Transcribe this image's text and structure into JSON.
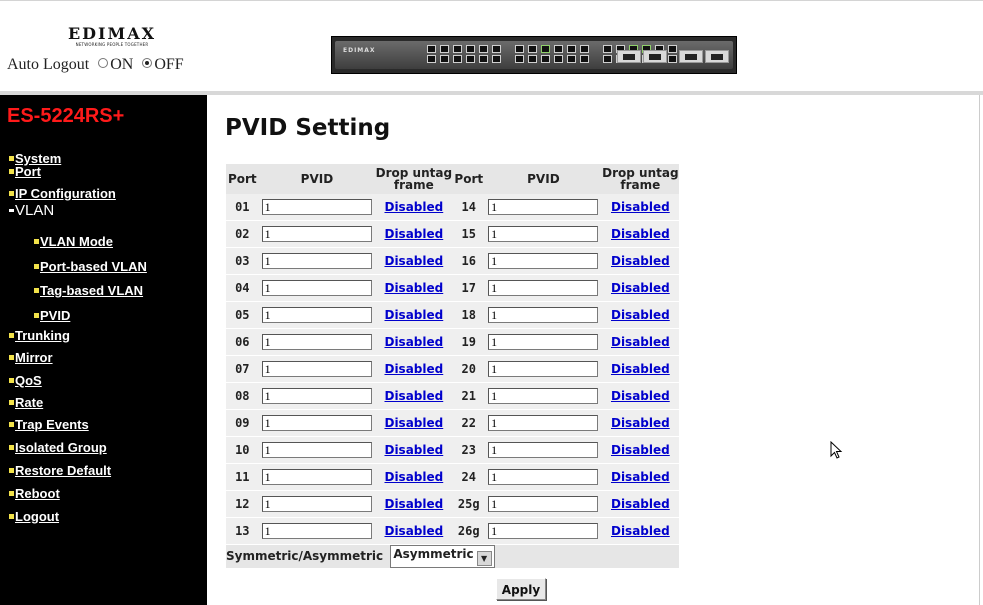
{
  "header": {
    "brand": "EDIMAX",
    "slogan": "NETWORKING PEOPLE TOGETHER",
    "auto_logout_label": "Auto Logout",
    "on_label": "ON",
    "off_label": "OFF",
    "auto_logout_selected": "OFF",
    "device_brand": "EDIMAX"
  },
  "sidebar": {
    "model": "ES-5224RS+",
    "items": [
      {
        "label": "System"
      },
      {
        "label": "Port"
      },
      {
        "label": "IP Configuration"
      },
      {
        "label": "VLAN"
      },
      {
        "label": "VLAN Mode"
      },
      {
        "label": "Port-based VLAN"
      },
      {
        "label": "Tag-based VLAN"
      },
      {
        "label": "PVID"
      },
      {
        "label": "Trunking"
      },
      {
        "label": "Mirror"
      },
      {
        "label": "QoS"
      },
      {
        "label": "Rate"
      },
      {
        "label": "Trap Events"
      },
      {
        "label": "Isolated Group"
      },
      {
        "label": "Restore Default"
      },
      {
        "label": "Reboot"
      },
      {
        "label": "Logout"
      }
    ]
  },
  "main": {
    "title": "PVID Setting",
    "headers": {
      "port": "Port",
      "pvid": "PVID",
      "drop_line1": "Drop untag",
      "drop_line2": "frame"
    },
    "rows": [
      {
        "l_port": "01",
        "l_pvid": "1",
        "l_drop": "Disabled",
        "r_port": "14",
        "r_pvid": "1",
        "r_drop": "Disabled"
      },
      {
        "l_port": "02",
        "l_pvid": "1",
        "l_drop": "Disabled",
        "r_port": "15",
        "r_pvid": "1",
        "r_drop": "Disabled"
      },
      {
        "l_port": "03",
        "l_pvid": "1",
        "l_drop": "Disabled",
        "r_port": "16",
        "r_pvid": "1",
        "r_drop": "Disabled"
      },
      {
        "l_port": "04",
        "l_pvid": "1",
        "l_drop": "Disabled",
        "r_port": "17",
        "r_pvid": "1",
        "r_drop": "Disabled"
      },
      {
        "l_port": "05",
        "l_pvid": "1",
        "l_drop": "Disabled",
        "r_port": "18",
        "r_pvid": "1",
        "r_drop": "Disabled"
      },
      {
        "l_port": "06",
        "l_pvid": "1",
        "l_drop": "Disabled",
        "r_port": "19",
        "r_pvid": "1",
        "r_drop": "Disabled"
      },
      {
        "l_port": "07",
        "l_pvid": "1",
        "l_drop": "Disabled",
        "r_port": "20",
        "r_pvid": "1",
        "r_drop": "Disabled"
      },
      {
        "l_port": "08",
        "l_pvid": "1",
        "l_drop": "Disabled",
        "r_port": "21",
        "r_pvid": "1",
        "r_drop": "Disabled"
      },
      {
        "l_port": "09",
        "l_pvid": "1",
        "l_drop": "Disabled",
        "r_port": "22",
        "r_pvid": "1",
        "r_drop": "Disabled"
      },
      {
        "l_port": "10",
        "l_pvid": "1",
        "l_drop": "Disabled",
        "r_port": "23",
        "r_pvid": "1",
        "r_drop": "Disabled"
      },
      {
        "l_port": "11",
        "l_pvid": "1",
        "l_drop": "Disabled",
        "r_port": "24",
        "r_pvid": "1",
        "r_drop": "Disabled"
      },
      {
        "l_port": "12",
        "l_pvid": "1",
        "l_drop": "Disabled",
        "r_port": "25g",
        "r_pvid": "1",
        "r_drop": "Disabled"
      },
      {
        "l_port": "13",
        "l_pvid": "1",
        "l_drop": "Disabled",
        "r_port": "26g",
        "r_pvid": "1",
        "r_drop": "Disabled"
      }
    ],
    "symmetric_label": "Symmetric/Asymmetric",
    "symmetric_value": "Asymmetric",
    "apply_label": "Apply"
  },
  "colors": {
    "sidebar_bg": "#000000",
    "model_text": "#ff1a1a",
    "bullet": "#f2e24a",
    "link": "#0000cc",
    "table_bg": "#efefef"
  }
}
